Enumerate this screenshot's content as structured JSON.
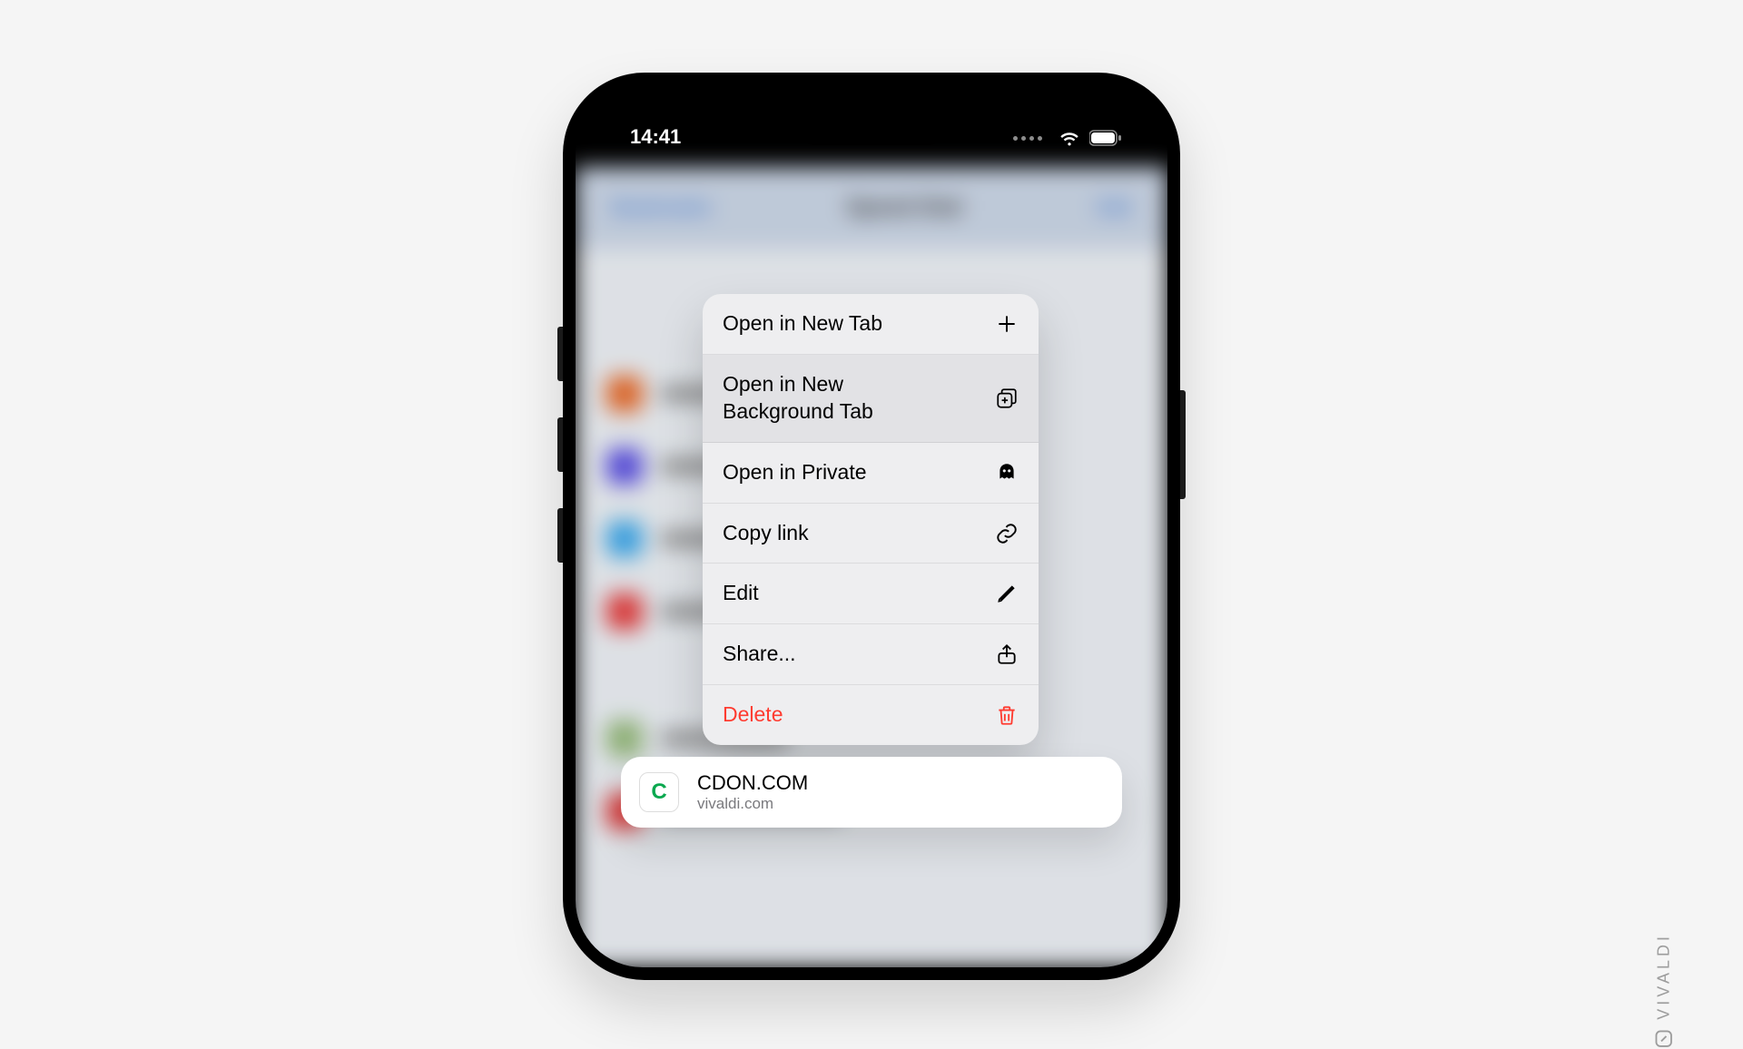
{
  "status_bar": {
    "time": "14:41"
  },
  "background": {
    "nav_left": "Bookmarks",
    "nav_title": "Speed Dial",
    "nav_right": "Edit"
  },
  "menu": {
    "items": [
      {
        "label": "Open in New Tab",
        "icon": "plus-icon",
        "destructive": false
      },
      {
        "label": "Open in New Background Tab",
        "icon": "stack-plus-icon",
        "destructive": false,
        "highlight": true
      },
      {
        "label": "Open in Private",
        "icon": "ghost-icon",
        "destructive": false
      },
      {
        "label": "Copy link",
        "icon": "link-icon",
        "destructive": false
      },
      {
        "label": "Edit",
        "icon": "pencil-icon",
        "destructive": false
      },
      {
        "label": "Share...",
        "icon": "share-icon",
        "destructive": false
      },
      {
        "label": "Delete",
        "icon": "trash-icon",
        "destructive": true
      }
    ]
  },
  "bookmark_card": {
    "favicon_letter": "C",
    "title": "CDON.COM",
    "url": "vivaldi.com"
  },
  "brand": "VIVALDI"
}
